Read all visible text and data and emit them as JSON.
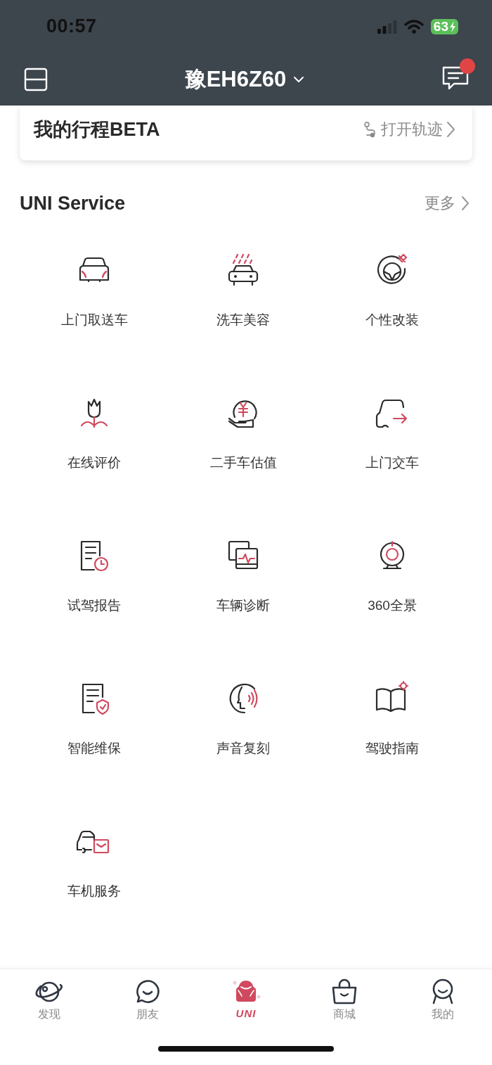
{
  "status_bar": {
    "time": "00:57",
    "battery": "63"
  },
  "header": {
    "title": "豫EH6Z60",
    "unread_messages": true
  },
  "trip_card": {
    "title": "我的行程BETA",
    "action": "打开轨迹"
  },
  "services": {
    "title": "UNI Service",
    "more": "更多",
    "items": [
      {
        "label": "上门取送车"
      },
      {
        "label": "洗车美容"
      },
      {
        "label": "个性改装"
      },
      {
        "label": "在线评价"
      },
      {
        "label": "二手车估值"
      },
      {
        "label": "上门交车"
      },
      {
        "label": "试驾报告"
      },
      {
        "label": "车辆诊断"
      },
      {
        "label": "360全景"
      },
      {
        "label": "智能维保"
      },
      {
        "label": "声音复刻"
      },
      {
        "label": "驾驶指南"
      },
      {
        "label": "车机服务"
      }
    ]
  },
  "tab_bar": [
    {
      "label": "发现",
      "selected": false
    },
    {
      "label": "朋友",
      "selected": false
    },
    {
      "label": "UNI",
      "selected": true
    },
    {
      "label": "商城",
      "selected": false
    },
    {
      "label": "我的",
      "selected": false
    }
  ]
}
